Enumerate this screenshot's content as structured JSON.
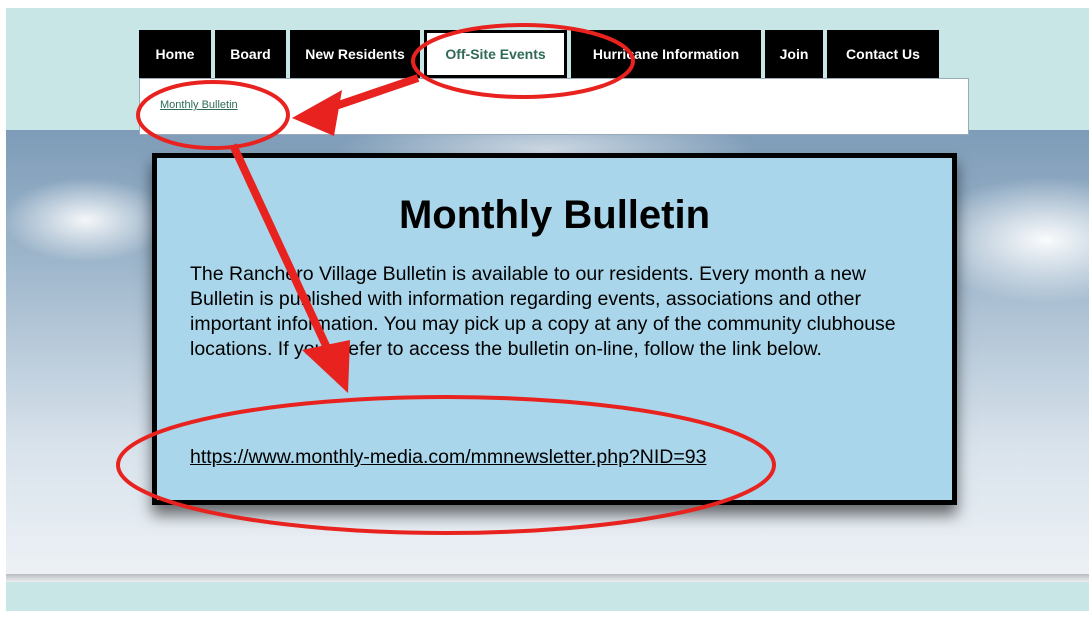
{
  "nav": {
    "items": [
      {
        "label": "Home"
      },
      {
        "label": "Board"
      },
      {
        "label": "New Residents"
      },
      {
        "label": "Off-Site Events"
      },
      {
        "label": "Hurricane Information"
      },
      {
        "label": "Join"
      },
      {
        "label": "Contact Us"
      }
    ],
    "active": "Off-Site Events"
  },
  "subnav": {
    "link": "Monthly Bulletin"
  },
  "content": {
    "title": "Monthly Bulletin",
    "text": "The Ranchero Village Bulletin is available to our residents. Every month a new Bulletin is published with information regarding events, associations and other important information.  You may pick up a copy at any of the community clubhouse locations.  If you prefer to access the bulletin on-line, follow the link below.",
    "link": "https://www.monthly-media.com/mmnewsletter.php?NID=93"
  },
  "colors": {
    "annotation": "#e8231f",
    "nav_bg": "#000000",
    "active_text": "#2f6b55",
    "box_bg": "#a9d6ea",
    "page_bg": "#c9e6e6"
  }
}
